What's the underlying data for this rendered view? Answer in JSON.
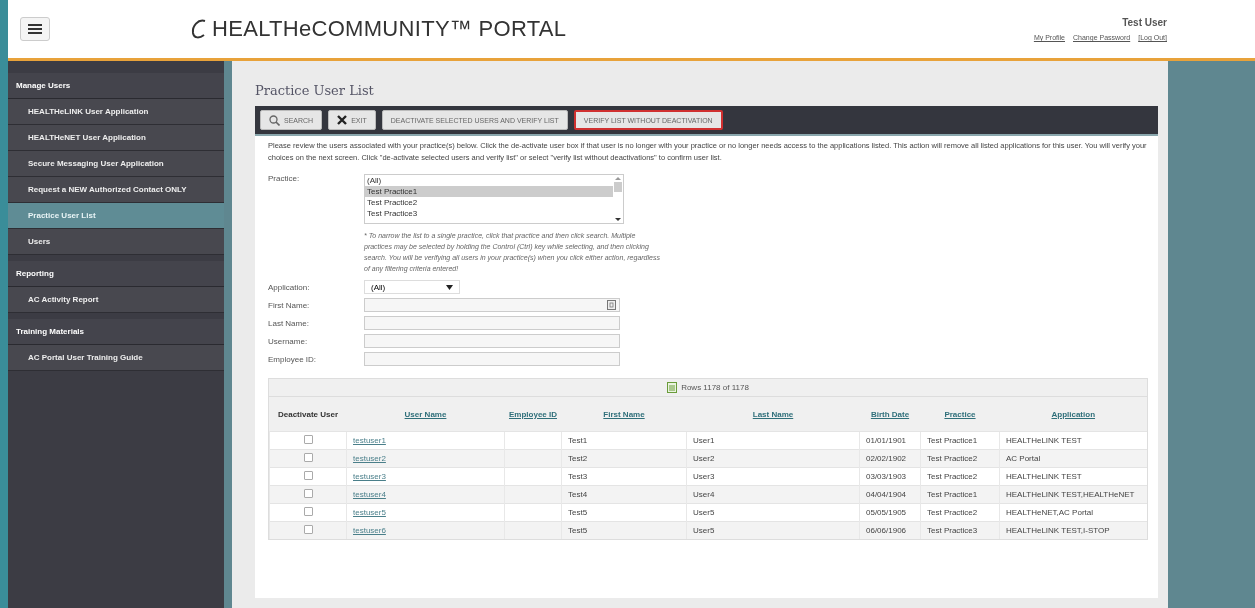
{
  "header": {
    "logo_text": "HEALTHeCOMMUNITY™ PORTAL",
    "user_name": "Test User",
    "links": [
      "My Profile",
      "Change Password",
      "[Log Out]"
    ]
  },
  "sidebar": {
    "sections": [
      {
        "title": "Manage Users",
        "items": [
          {
            "label": "HEALTHeLINK User Application",
            "selected": false
          },
          {
            "label": "HEALTHeNET User Application",
            "selected": false
          },
          {
            "label": "Secure Messaging User Application",
            "selected": false
          },
          {
            "label": "Request a NEW Authorized Contact ONLY",
            "selected": false
          },
          {
            "label": "Practice User List",
            "selected": true
          },
          {
            "label": "Users",
            "selected": false
          }
        ]
      },
      {
        "title": "Reporting",
        "items": [
          {
            "label": "AC Activity Report",
            "selected": false
          }
        ]
      },
      {
        "title": "Training Materials",
        "items": [
          {
            "label": "AC Portal User Training Guide",
            "selected": false
          }
        ]
      }
    ]
  },
  "page_title": "Practice User List",
  "toolbar": {
    "buttons": [
      {
        "label": "SEARCH",
        "kind": "search",
        "highlighted": false
      },
      {
        "label": "EXIT",
        "kind": "exit",
        "highlighted": false
      },
      {
        "label": "DEACTIVATE SELECTED USERS AND VERIFY LIST",
        "kind": "plain",
        "highlighted": false
      },
      {
        "label": "VERIFY LIST WITHOUT DEACTIVATION",
        "kind": "plain",
        "highlighted": true
      }
    ]
  },
  "description": "Please review the users associated with your practice(s) below. Click the de-activate user box if that user is no longer with your practice or no longer needs access to the applications listed. This action will remove all listed applications for this user. You will verify your choices on the next screen. Click \"de-activate selected users and verify list\" or select \"verify list without deactivations\" to confirm user list.",
  "form": {
    "practice": {
      "label": "Practice:",
      "options": [
        {
          "label": "(All)",
          "selected": false
        },
        {
          "label": "Test Practice1",
          "selected": true
        },
        {
          "label": "Test Practice2",
          "selected": false
        },
        {
          "label": "Test Practice3",
          "selected": false
        }
      ]
    },
    "note": "* To narrow the list to a single practice, click that practice and then click search. Multiple practices may be selected by holding the Control (Ctrl) key while selecting, and then clicking search. You will be verifying all users in your practice(s) when you click either action, regardless of any filtering criteria entered!",
    "fields": [
      {
        "label": "Application:",
        "kind": "select",
        "value": "(All)"
      },
      {
        "label": "First Name:",
        "kind": "date"
      },
      {
        "label": "Last Name:",
        "kind": "text"
      },
      {
        "label": "Username:",
        "kind": "text"
      },
      {
        "label": "Employee ID:",
        "kind": "text"
      }
    ]
  },
  "table": {
    "rows_info": "Rows 1178 of 1178",
    "columns": [
      {
        "label": "Deactivate User",
        "sortable": false
      },
      {
        "label": "User Name",
        "sortable": true
      },
      {
        "label": "Employee ID",
        "sortable": true
      },
      {
        "label": "First Name",
        "sortable": true
      },
      {
        "label": "Last Name",
        "sortable": true
      },
      {
        "label": "Birth Date",
        "sortable": true
      },
      {
        "label": "Practice",
        "sortable": true
      },
      {
        "label": "Application",
        "sortable": true
      }
    ],
    "rows": [
      {
        "checked": false,
        "user_name": "testuser1",
        "first_name": "Test1",
        "last_name": "User1",
        "birth_date": "01/01/1901",
        "practice": "Test Practice1",
        "application": "HEALTHeLINK TEST"
      },
      {
        "checked": false,
        "user_name": "testuser2",
        "first_name": "Test2",
        "last_name": "User2",
        "birth_date": "02/02/1902",
        "practice": "Test Practice2",
        "application": "AC Portal"
      },
      {
        "checked": false,
        "user_name": "testuser3",
        "first_name": "Test3",
        "last_name": "User3",
        "birth_date": "03/03/1903",
        "practice": "Test Practice2",
        "application": "HEALTHeLINK TEST"
      },
      {
        "checked": false,
        "user_name": "testuser4",
        "first_name": "Test4",
        "last_name": "User4",
        "birth_date": "04/04/1904",
        "practice": "Test Practice1",
        "application": "HEALTHeLINK TEST,HEALTHeNET"
      },
      {
        "checked": false,
        "user_name": "testuser5",
        "first_name": "Test5",
        "last_name": "User5",
        "birth_date": "05/05/1905",
        "practice": "Test Practice2",
        "application": "HEALTHeNET,AC Portal"
      },
      {
        "checked": false,
        "user_name": "testuser6",
        "first_name": "Test5",
        "last_name": "User5",
        "birth_date": "06/06/1906",
        "practice": "Test Practice3",
        "application": "HEALTHeLINK TEST,I-STOP"
      }
    ]
  }
}
